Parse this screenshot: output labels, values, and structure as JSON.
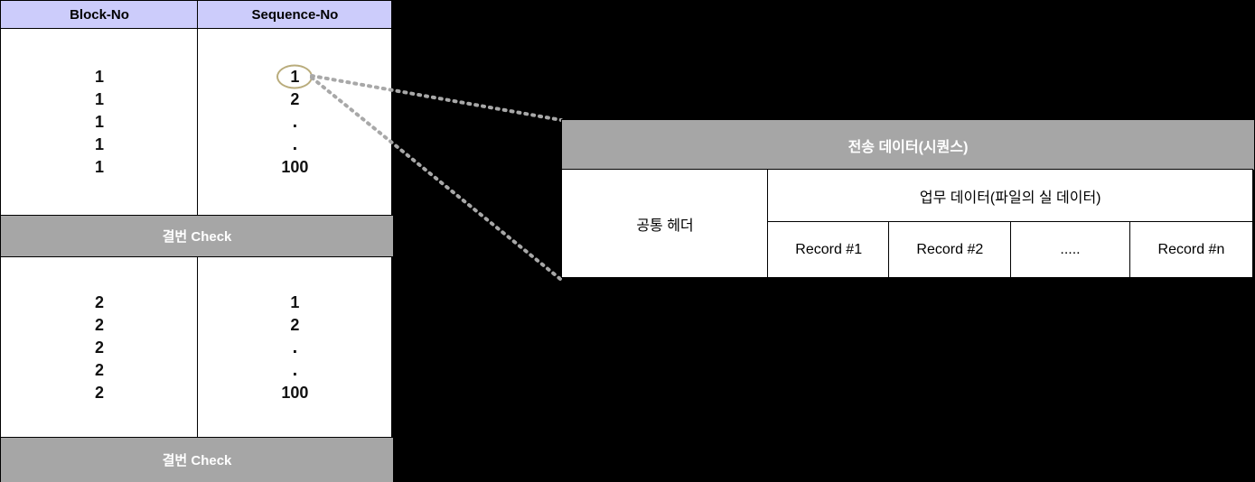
{
  "background_color": "#000000",
  "sequence_table": {
    "columns": [
      {
        "label": "Block-No"
      },
      {
        "label": "Sequence-No"
      }
    ],
    "header_bg": "#ccccfb",
    "blocks": [
      {
        "block_no_values": [
          "1",
          "1",
          "1",
          "1",
          "1"
        ],
        "sequence_no_values": [
          "1",
          "2",
          ".",
          ".",
          "100"
        ],
        "highlight_index": 0,
        "highlight_color": "#b9ac7c",
        "gap_check_label": "결번 Check"
      },
      {
        "block_no_values": [
          "2",
          "2",
          "2",
          "2",
          "2"
        ],
        "sequence_no_values": [
          "1",
          "2",
          ".",
          ".",
          "100"
        ],
        "highlight_index": -1,
        "gap_check_label": "결번 Check"
      }
    ],
    "band_bg": "#a6a6a6",
    "band_text_color": "#ffffff"
  },
  "transmission_data": {
    "header_label": "전송 데이터(시퀀스)",
    "header_bg": "#a6a6a6",
    "common_header_label": "공통 헤더",
    "payload_title": "업무 데이터(파일의 실 데이터)",
    "records": [
      {
        "label": "Record #1"
      },
      {
        "label": "Record #2"
      },
      {
        "label": "....."
      },
      {
        "label": "Record #n"
      }
    ]
  },
  "connectors": {
    "line_color": "#a8a8a8",
    "style": "dotted",
    "from_label": "circled sequence number 1",
    "to_labels": [
      "전송 데이터(시퀀스) top-left",
      "전송 데이터(시퀀스) bottom-left"
    ]
  }
}
